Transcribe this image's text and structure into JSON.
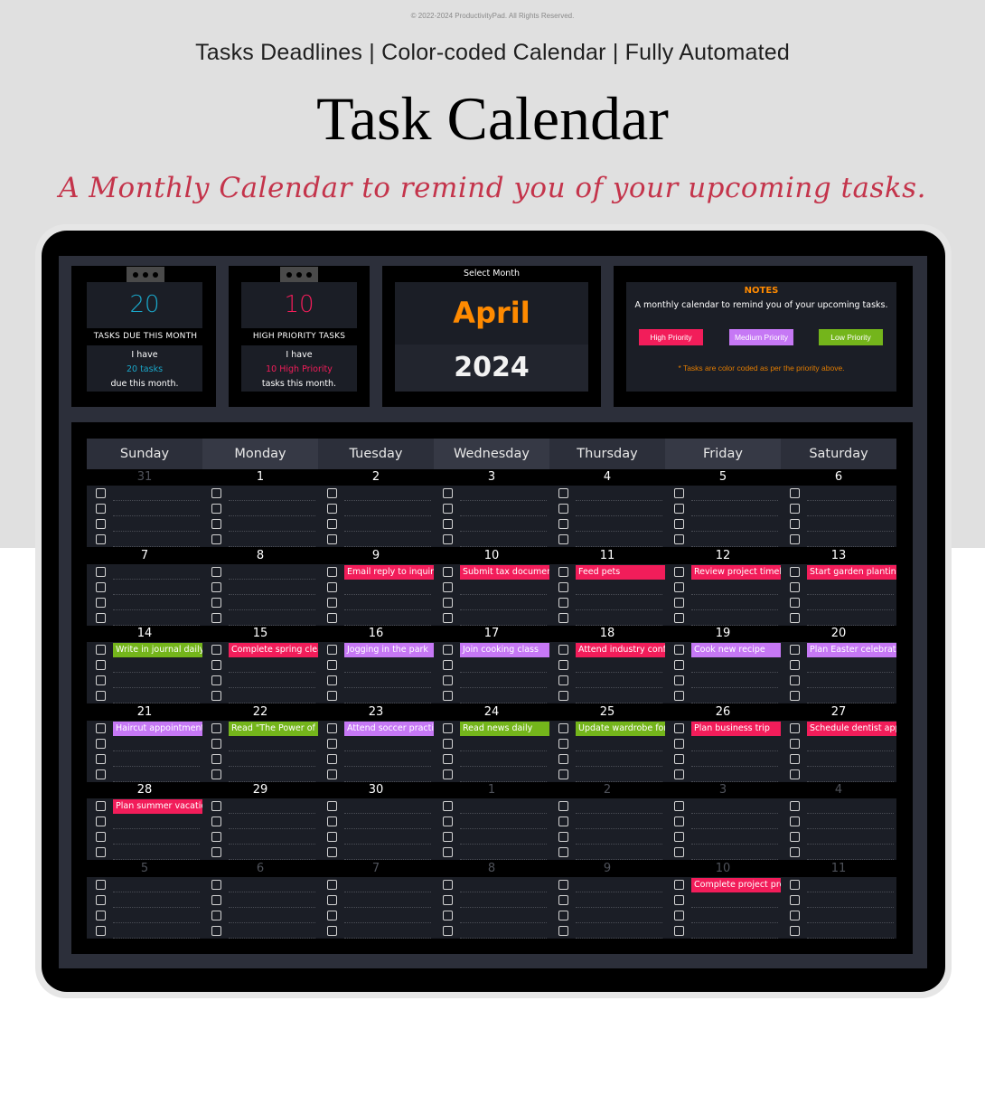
{
  "banner": {
    "copyright": "© 2022-2024 ProductivityPad. All Rights Reserved.",
    "tagline": "Tasks Deadlines  | Color-coded Calendar | Fully Automated",
    "title": "Task Calendar",
    "subtitle": "A Monthly Calendar to remind you of your upcoming tasks."
  },
  "colors": {
    "high": "#f21d5a",
    "medium": "#c678f5",
    "low": "#74b51b",
    "accent_orange": "#ff8a00",
    "accent_cyan": "#1aa6c8"
  },
  "stats": {
    "tasks_due": {
      "value": "20",
      "label": "TASKS DUE THIS MONTH",
      "line1": "I have",
      "highlight": "20 tasks",
      "line3": "due this month."
    },
    "high_priority": {
      "value": "10",
      "label": "HIGH PRIORITY TASKS",
      "line1": "I have",
      "highlight": "10 High Priority",
      "line3": "tasks this month."
    }
  },
  "month_select": {
    "label": "Select Month",
    "month": "April",
    "year": "2024"
  },
  "notes": {
    "title": "NOTES",
    "text": "A monthly calendar to remind you of your upcoming tasks.",
    "legend": [
      {
        "label": "High Priority",
        "priority": "high"
      },
      {
        "label": "Medium Priority",
        "priority": "medium"
      },
      {
        "label": "Low Priority",
        "priority": "low"
      }
    ],
    "footnote": "* Tasks are color coded as per the priority above."
  },
  "calendar": {
    "weekdays": [
      "Sunday",
      "Monday",
      "Tuesday",
      "Wednesday",
      "Thursday",
      "Friday",
      "Saturday"
    ],
    "weeks": [
      [
        {
          "date": "31",
          "current": false,
          "tasks": []
        },
        {
          "date": "1",
          "current": true,
          "tasks": []
        },
        {
          "date": "2",
          "current": true,
          "tasks": []
        },
        {
          "date": "3",
          "current": true,
          "tasks": []
        },
        {
          "date": "4",
          "current": true,
          "tasks": []
        },
        {
          "date": "5",
          "current": true,
          "tasks": []
        },
        {
          "date": "6",
          "current": true,
          "tasks": []
        }
      ],
      [
        {
          "date": "7",
          "current": true,
          "tasks": []
        },
        {
          "date": "8",
          "current": true,
          "tasks": []
        },
        {
          "date": "9",
          "current": true,
          "tasks": [
            {
              "text": "Email reply to inquiries",
              "priority": "high"
            }
          ]
        },
        {
          "date": "10",
          "current": true,
          "tasks": [
            {
              "text": "Submit tax documents",
              "priority": "high"
            }
          ]
        },
        {
          "date": "11",
          "current": true,
          "tasks": [
            {
              "text": "Feed pets",
              "priority": "high"
            }
          ]
        },
        {
          "date": "12",
          "current": true,
          "tasks": [
            {
              "text": "Review project timeline",
              "priority": "high"
            }
          ]
        },
        {
          "date": "13",
          "current": true,
          "tasks": [
            {
              "text": "Start garden planting",
              "priority": "high"
            }
          ]
        }
      ],
      [
        {
          "date": "14",
          "current": true,
          "tasks": [
            {
              "text": "Write in journal daily",
              "priority": "low"
            }
          ]
        },
        {
          "date": "15",
          "current": true,
          "tasks": [
            {
              "text": "Complete spring cleaning",
              "priority": "high"
            }
          ]
        },
        {
          "date": "16",
          "current": true,
          "tasks": [
            {
              "text": "Jogging in the park",
              "priority": "medium"
            }
          ]
        },
        {
          "date": "17",
          "current": true,
          "tasks": [
            {
              "text": "Join cooking class",
              "priority": "medium"
            }
          ]
        },
        {
          "date": "18",
          "current": true,
          "tasks": [
            {
              "text": "Attend industry conference",
              "priority": "high"
            }
          ]
        },
        {
          "date": "19",
          "current": true,
          "tasks": [
            {
              "text": "Cook new recipe",
              "priority": "medium"
            }
          ]
        },
        {
          "date": "20",
          "current": true,
          "tasks": [
            {
              "text": "Plan Easter celebration",
              "priority": "medium"
            }
          ]
        }
      ],
      [
        {
          "date": "21",
          "current": true,
          "tasks": [
            {
              "text": "Haircut appointment",
              "priority": "medium"
            }
          ]
        },
        {
          "date": "22",
          "current": true,
          "tasks": [
            {
              "text": "Read \"The Power of Habit\"",
              "priority": "low"
            }
          ]
        },
        {
          "date": "23",
          "current": true,
          "tasks": [
            {
              "text": "Attend soccer practice",
              "priority": "medium"
            }
          ]
        },
        {
          "date": "24",
          "current": true,
          "tasks": [
            {
              "text": "Read news daily",
              "priority": "low"
            }
          ]
        },
        {
          "date": "25",
          "current": true,
          "tasks": [
            {
              "text": "Update wardrobe for spring",
              "priority": "low"
            }
          ]
        },
        {
          "date": "26",
          "current": true,
          "tasks": [
            {
              "text": "Plan business trip",
              "priority": "high"
            }
          ]
        },
        {
          "date": "27",
          "current": true,
          "tasks": [
            {
              "text": "Schedule dentist appointment",
              "priority": "high"
            }
          ]
        }
      ],
      [
        {
          "date": "28",
          "current": true,
          "tasks": [
            {
              "text": "Plan summer vacation",
              "priority": "high"
            }
          ]
        },
        {
          "date": "29",
          "current": true,
          "tasks": []
        },
        {
          "date": "30",
          "current": true,
          "tasks": []
        },
        {
          "date": "1",
          "current": false,
          "tasks": []
        },
        {
          "date": "2",
          "current": false,
          "tasks": []
        },
        {
          "date": "3",
          "current": false,
          "tasks": []
        },
        {
          "date": "4",
          "current": false,
          "tasks": []
        }
      ],
      [
        {
          "date": "5",
          "current": false,
          "tasks": []
        },
        {
          "date": "6",
          "current": false,
          "tasks": []
        },
        {
          "date": "7",
          "current": false,
          "tasks": []
        },
        {
          "date": "8",
          "current": false,
          "tasks": []
        },
        {
          "date": "9",
          "current": false,
          "tasks": []
        },
        {
          "date": "10",
          "current": false,
          "tasks": [
            {
              "text": "Complete project presentation",
              "priority": "high"
            }
          ]
        },
        {
          "date": "11",
          "current": false,
          "tasks": []
        }
      ]
    ]
  }
}
